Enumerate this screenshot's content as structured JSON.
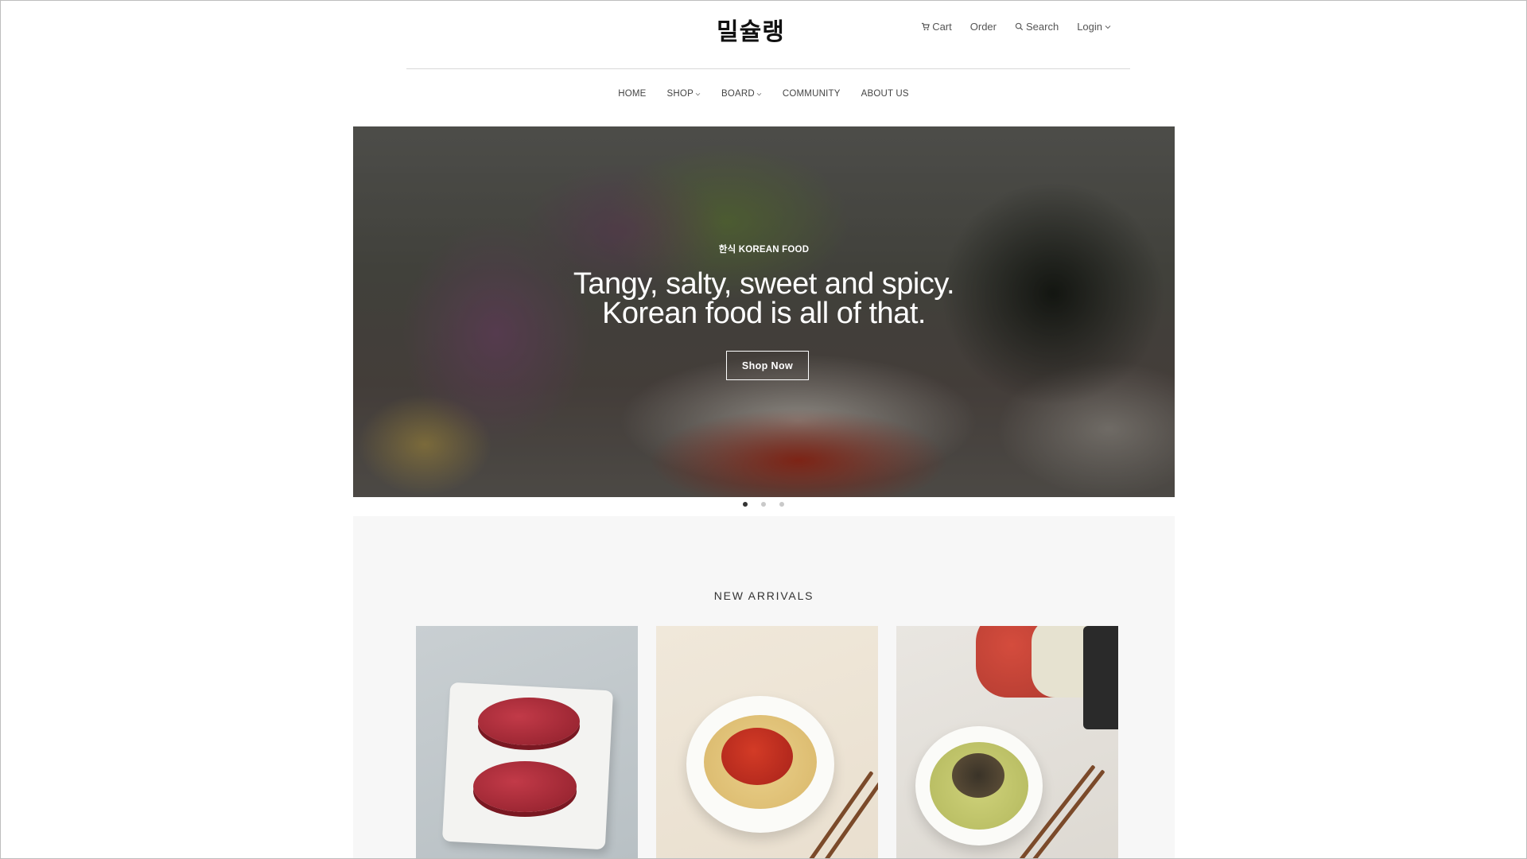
{
  "header": {
    "logo": "밀슐랭",
    "utility": {
      "cart": "Cart",
      "order": "Order",
      "search": "Search",
      "login": "Login"
    }
  },
  "nav": {
    "items": [
      {
        "label": "HOME",
        "dropdown": false
      },
      {
        "label": "SHOP",
        "dropdown": true
      },
      {
        "label": "BOARD",
        "dropdown": true
      },
      {
        "label": "COMMUNITY",
        "dropdown": false
      },
      {
        "label": "ABOUT US",
        "dropdown": false
      }
    ]
  },
  "hero": {
    "eyebrow": "한식 KOREAN FOOD",
    "title_line1": "Tangy, salty, sweet and spicy.",
    "title_line2": "Korean food is all of that.",
    "button": "Shop Now",
    "slides": 3,
    "active_slide": 1
  },
  "arrivals": {
    "title": "NEW ARRIVALS",
    "products": [
      {
        "image": "raw-beef-steaks-on-marble-board"
      },
      {
        "image": "noodles-with-red-sauce-in-bowl"
      },
      {
        "image": "cold-noodle-meal-kit"
      }
    ]
  },
  "colors": {
    "text": "#222222",
    "muted": "#555555",
    "section_bg": "#f7f7f7",
    "dot_active": "#333333",
    "dot_inactive": "#c9c9c9"
  }
}
